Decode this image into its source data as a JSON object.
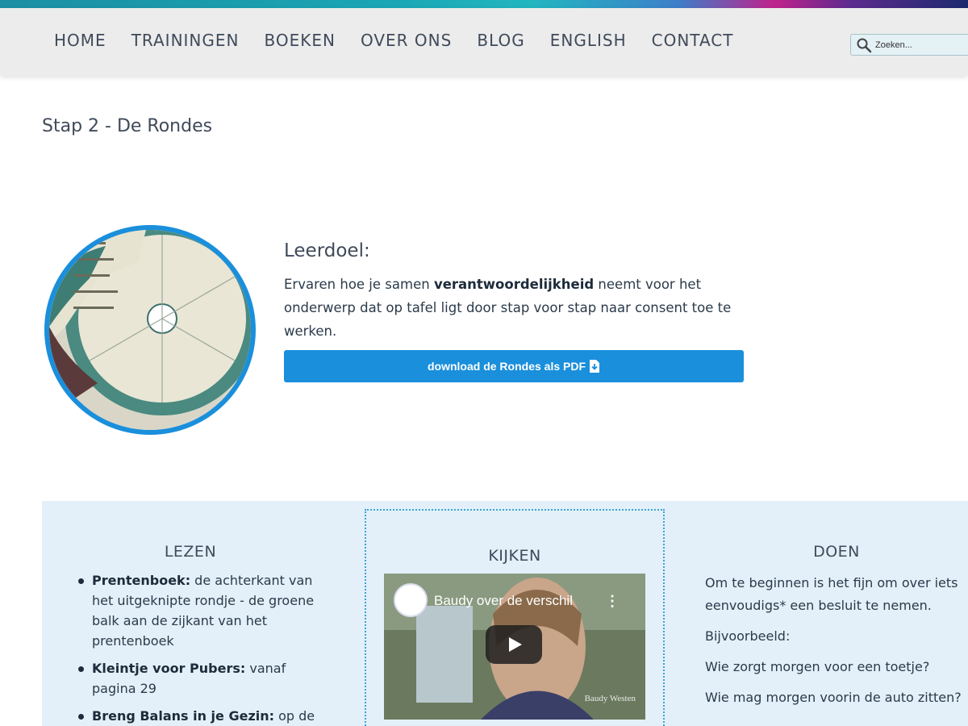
{
  "nav": {
    "items": [
      "HOME",
      "TRAININGEN",
      "BOEKEN",
      "OVER ONS",
      "BLOG",
      "ENGLISH",
      "CONTACT"
    ],
    "search_placeholder": "Zoeken..."
  },
  "page": {
    "title": "Stap 2 - De Rondes"
  },
  "leerdoel": {
    "heading": "Leerdoel:",
    "text_before": "Ervaren hoe je samen ",
    "text_bold": "verantwoordelijkheid",
    "text_after": " neemt voor het onderwerp dat op tafel ligt door stap voor stap naar consent toe te werken.",
    "download_label": "download de Rondes als PDF"
  },
  "lezen": {
    "heading": "LEZEN",
    "items": [
      {
        "bold": "Prentenboek:",
        "text": " de achterkant van het uitgeknipte rondje - de groene balk aan de zijkant van het prentenboek"
      },
      {
        "bold": "Kleintje voor Pubers:",
        "text": " vanaf pagina 29"
      },
      {
        "bold": "Breng Balans in je Gezin:",
        "text": " op de"
      }
    ]
  },
  "kijken": {
    "heading": "KIJKEN",
    "video_title": "Baudy over de verschil",
    "video_caption": "Baudy Westen"
  },
  "doen": {
    "heading": "DOEN",
    "paragraphs": [
      "Om te beginnen is het fijn om over iets eenvoudigs* een besluit te nemen.",
      "Bijvoorbeeld:",
      "Wie zorgt morgen voor een toetje?",
      "Wie mag morgen voorin de auto zitten?"
    ]
  },
  "colors": {
    "accent_blue": "#1a8fdc",
    "panel_bg": "#e3f0f9",
    "nav_bg": "#ececec"
  }
}
